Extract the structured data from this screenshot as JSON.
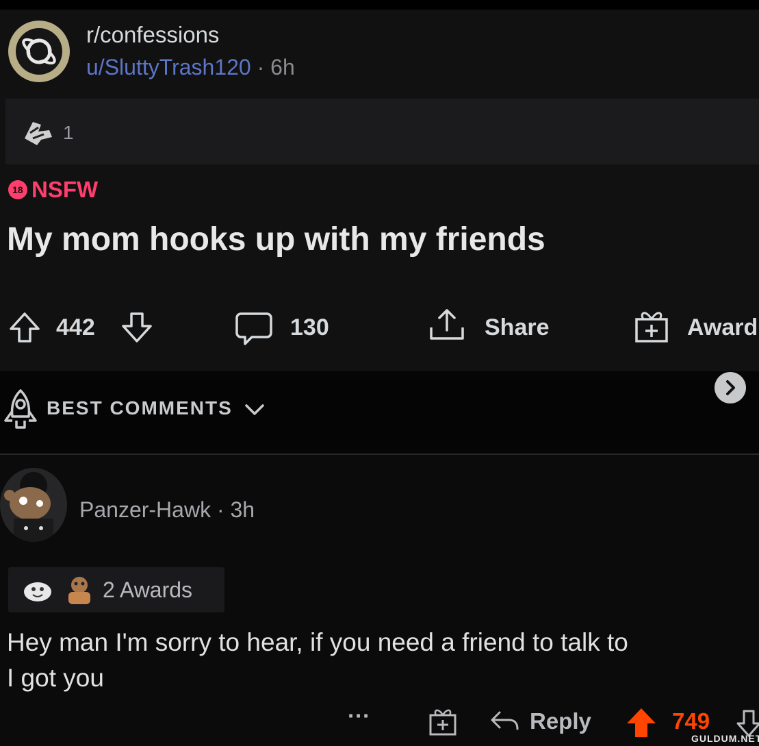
{
  "post": {
    "subreddit": "r/confessions",
    "author": "u/SluttyTrash120",
    "separator": "·",
    "age": "6h",
    "award_count": "1",
    "nsfw_badge": "18",
    "nsfw_label": "NSFW",
    "title": "My mom hooks up with my friends",
    "upvotes": "442",
    "comments": "130",
    "share_label": "Share",
    "award_label": "Award"
  },
  "sort": {
    "label": "BEST COMMENTS"
  },
  "comment": {
    "author": "Panzer-Hawk",
    "separator": "·",
    "age": "3h",
    "awards_label": "2 Awards",
    "body": "Hey man I'm sorry to hear, if you need a friend to talk to\nI got you",
    "more_label": "···",
    "reply_label": "Reply",
    "score": "749"
  },
  "watermark": "GULDUM.NET",
  "colors": {
    "nsfw": "#ff3e6c",
    "username_link": "#5d76c8",
    "upvoted": "#ff4500",
    "subreddit_icon_bg": "#b7ad87"
  },
  "icons": [
    "planet-icon",
    "award-icon",
    "upvote-icon",
    "downvote-icon",
    "comment-icon",
    "share-icon",
    "gift-icon",
    "rocket-icon",
    "chevron-down-icon",
    "chevron-right-icon"
  ]
}
